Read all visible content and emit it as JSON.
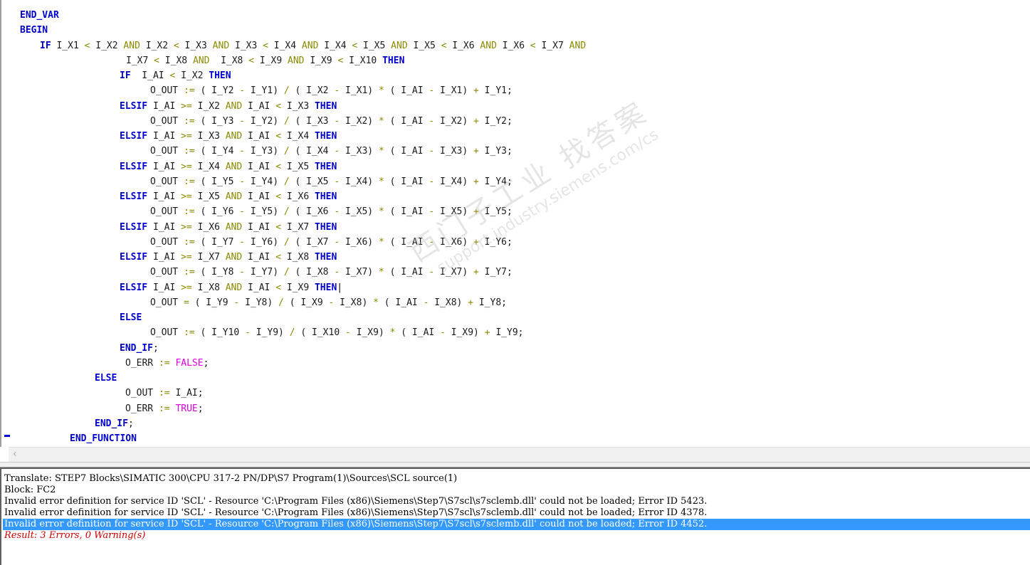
{
  "editor": {
    "lines": [
      [
        [
          "kw",
          "END_VAR"
        ]
      ],
      [
        [
          "kw",
          "BEGIN"
        ]
      ],
      [
        [
          "kw",
          "IF"
        ],
        [
          "txt",
          " I_X1 "
        ],
        [
          "op",
          "<"
        ],
        [
          "txt",
          " I_X2 "
        ],
        [
          "kwa",
          "AND"
        ],
        [
          "txt",
          " I_X2 "
        ],
        [
          "op",
          "<"
        ],
        [
          "txt",
          " I_X3 "
        ],
        [
          "kwa",
          "AND"
        ],
        [
          "txt",
          " I_X3 "
        ],
        [
          "op",
          "<"
        ],
        [
          "txt",
          " I_X4 "
        ],
        [
          "kwa",
          "AND"
        ],
        [
          "txt",
          " I_X4 "
        ],
        [
          "op",
          "<"
        ],
        [
          "txt",
          " I_X5 "
        ],
        [
          "kwa",
          "AND"
        ],
        [
          "txt",
          " I_X5 "
        ],
        [
          "op",
          "<"
        ],
        [
          "txt",
          " I_X6 "
        ],
        [
          "kwa",
          "AND"
        ],
        [
          "txt",
          " I_X6 "
        ],
        [
          "op",
          "<"
        ],
        [
          "txt",
          " I_X7 "
        ],
        [
          "kwa",
          "AND"
        ]
      ],
      [
        [
          "txt",
          "I_X7 "
        ],
        [
          "op",
          "<"
        ],
        [
          "txt",
          " I_X8 "
        ],
        [
          "kwa",
          "AND"
        ],
        [
          "txt",
          "  I_X8 "
        ],
        [
          "op",
          "<"
        ],
        [
          "txt",
          " I_X9 "
        ],
        [
          "kwa",
          "AND"
        ],
        [
          "txt",
          " I_X9 "
        ],
        [
          "op",
          "<"
        ],
        [
          "txt",
          " I_X10 "
        ],
        [
          "kw",
          "THEN"
        ]
      ],
      [
        [
          "kw",
          "IF"
        ],
        [
          "txt",
          "  I_AI "
        ],
        [
          "op",
          "<"
        ],
        [
          "txt",
          " I_X2 "
        ],
        [
          "kw",
          "THEN"
        ]
      ],
      [
        [
          "txt",
          "O_OUT "
        ],
        [
          "op",
          ":="
        ],
        [
          "txt",
          " ( I_Y2 "
        ],
        [
          "op",
          "-"
        ],
        [
          "txt",
          " I_Y1) "
        ],
        [
          "op",
          "/"
        ],
        [
          "txt",
          " ( I_X2 "
        ],
        [
          "op",
          "-"
        ],
        [
          "txt",
          " I_X1) "
        ],
        [
          "op",
          "*"
        ],
        [
          "txt",
          " ( I_AI "
        ],
        [
          "op",
          "-"
        ],
        [
          "txt",
          " I_X1) "
        ],
        [
          "op",
          "+"
        ],
        [
          "txt",
          " I_Y1;"
        ]
      ],
      [
        [
          "kw",
          "ELSIF"
        ],
        [
          "txt",
          " I_AI "
        ],
        [
          "op",
          ">="
        ],
        [
          "txt",
          " I_X2 "
        ],
        [
          "kwa",
          "AND"
        ],
        [
          "txt",
          " I_AI "
        ],
        [
          "op",
          "<"
        ],
        [
          "txt",
          " I_X3 "
        ],
        [
          "kw",
          "THEN"
        ]
      ],
      [
        [
          "txt",
          "O_OUT "
        ],
        [
          "op",
          ":="
        ],
        [
          "txt",
          " ( I_Y3 "
        ],
        [
          "op",
          "-"
        ],
        [
          "txt",
          " I_Y2) "
        ],
        [
          "op",
          "/"
        ],
        [
          "txt",
          " ( I_X3 "
        ],
        [
          "op",
          "-"
        ],
        [
          "txt",
          " I_X2) "
        ],
        [
          "op",
          "*"
        ],
        [
          "txt",
          " ( I_AI "
        ],
        [
          "op",
          "-"
        ],
        [
          "txt",
          " I_X2) "
        ],
        [
          "op",
          "+"
        ],
        [
          "txt",
          " I_Y2;"
        ]
      ],
      [
        [
          "kw",
          "ELSIF"
        ],
        [
          "txt",
          " I_AI "
        ],
        [
          "op",
          ">="
        ],
        [
          "txt",
          " I_X3 "
        ],
        [
          "kwa",
          "AND"
        ],
        [
          "txt",
          " I_AI "
        ],
        [
          "op",
          "<"
        ],
        [
          "txt",
          " I_X4 "
        ],
        [
          "kw",
          "THEN"
        ]
      ],
      [
        [
          "txt",
          "O_OUT "
        ],
        [
          "op",
          ":="
        ],
        [
          "txt",
          " ( I_Y4 "
        ],
        [
          "op",
          "-"
        ],
        [
          "txt",
          " I_Y3) "
        ],
        [
          "op",
          "/"
        ],
        [
          "txt",
          " ( I_X4 "
        ],
        [
          "op",
          "-"
        ],
        [
          "txt",
          " I_X3) "
        ],
        [
          "op",
          "*"
        ],
        [
          "txt",
          " ( I_AI "
        ],
        [
          "op",
          "-"
        ],
        [
          "txt",
          " I_X3) "
        ],
        [
          "op",
          "+"
        ],
        [
          "txt",
          " I_Y3;"
        ]
      ],
      [
        [
          "kw",
          "ELSIF"
        ],
        [
          "txt",
          " I_AI "
        ],
        [
          "op",
          ">="
        ],
        [
          "txt",
          " I_X4 "
        ],
        [
          "kwa",
          "AND"
        ],
        [
          "txt",
          " I_AI "
        ],
        [
          "op",
          "<"
        ],
        [
          "txt",
          " I_X5 "
        ],
        [
          "kw",
          "THEN"
        ]
      ],
      [
        [
          "txt",
          "O_OUT "
        ],
        [
          "op",
          ":="
        ],
        [
          "txt",
          " ( I_Y5 "
        ],
        [
          "op",
          "-"
        ],
        [
          "txt",
          " I_Y4) "
        ],
        [
          "op",
          "/"
        ],
        [
          "txt",
          " ( I_X5 "
        ],
        [
          "op",
          "-"
        ],
        [
          "txt",
          " I_X4) "
        ],
        [
          "op",
          "*"
        ],
        [
          "txt",
          " ( I_AI "
        ],
        [
          "op",
          "-"
        ],
        [
          "txt",
          " I_X4) "
        ],
        [
          "op",
          "+"
        ],
        [
          "txt",
          " I_Y4;"
        ]
      ],
      [
        [
          "kw",
          "ELSIF"
        ],
        [
          "txt",
          " I_AI "
        ],
        [
          "op",
          ">="
        ],
        [
          "txt",
          " I_X5 "
        ],
        [
          "kwa",
          "AND"
        ],
        [
          "txt",
          " I_AI "
        ],
        [
          "op",
          "<"
        ],
        [
          "txt",
          " I_X6 "
        ],
        [
          "kw",
          "THEN"
        ]
      ],
      [
        [
          "txt",
          "O_OUT "
        ],
        [
          "op",
          ":="
        ],
        [
          "txt",
          " ( I_Y6 "
        ],
        [
          "op",
          "-"
        ],
        [
          "txt",
          " I_Y5) "
        ],
        [
          "op",
          "/"
        ],
        [
          "txt",
          " ( I_X6 "
        ],
        [
          "op",
          "-"
        ],
        [
          "txt",
          " I_X5) "
        ],
        [
          "op",
          "*"
        ],
        [
          "txt",
          " ( I_AI "
        ],
        [
          "op",
          "-"
        ],
        [
          "txt",
          " I_X5) "
        ],
        [
          "op",
          "+"
        ],
        [
          "txt",
          " I_Y5;"
        ]
      ],
      [
        [
          "kw",
          "ELSIF"
        ],
        [
          "txt",
          " I_AI "
        ],
        [
          "op",
          ">="
        ],
        [
          "txt",
          " I_X6 "
        ],
        [
          "kwa",
          "AND"
        ],
        [
          "txt",
          " I_AI "
        ],
        [
          "op",
          "<"
        ],
        [
          "txt",
          " I_X7 "
        ],
        [
          "kw",
          "THEN"
        ]
      ],
      [
        [
          "txt",
          "O_OUT "
        ],
        [
          "op",
          ":="
        ],
        [
          "txt",
          " ( I_Y7 "
        ],
        [
          "op",
          "-"
        ],
        [
          "txt",
          " I_Y6) "
        ],
        [
          "op",
          "/"
        ],
        [
          "txt",
          " ( I_X7 "
        ],
        [
          "op",
          "-"
        ],
        [
          "txt",
          " I_X6) "
        ],
        [
          "op",
          "*"
        ],
        [
          "txt",
          " ( I_AI "
        ],
        [
          "op",
          "-"
        ],
        [
          "txt",
          " I_X6) "
        ],
        [
          "op",
          "+"
        ],
        [
          "txt",
          " I_Y6;"
        ]
      ],
      [
        [
          "kw",
          "ELSIF"
        ],
        [
          "txt",
          " I_AI "
        ],
        [
          "op",
          ">="
        ],
        [
          "txt",
          " I_X7 "
        ],
        [
          "kwa",
          "AND"
        ],
        [
          "txt",
          " I_AI "
        ],
        [
          "op",
          "<"
        ],
        [
          "txt",
          " I_X8 "
        ],
        [
          "kw",
          "THEN"
        ]
      ],
      [
        [
          "txt",
          "O_OUT "
        ],
        [
          "op",
          ":="
        ],
        [
          "txt",
          " ( I_Y8 "
        ],
        [
          "op",
          "-"
        ],
        [
          "txt",
          " I_Y7) "
        ],
        [
          "op",
          "/"
        ],
        [
          "txt",
          " ( I_X8 "
        ],
        [
          "op",
          "-"
        ],
        [
          "txt",
          " I_X7) "
        ],
        [
          "op",
          "*"
        ],
        [
          "txt",
          " ( I_AI "
        ],
        [
          "op",
          "-"
        ],
        [
          "txt",
          " I_X7) "
        ],
        [
          "op",
          "+"
        ],
        [
          "txt",
          " I_Y7;"
        ]
      ],
      [
        [
          "kw",
          "ELSIF"
        ],
        [
          "txt",
          " I_AI "
        ],
        [
          "op",
          ">="
        ],
        [
          "txt",
          " I_X8 "
        ],
        [
          "kwa",
          "AND"
        ],
        [
          "txt",
          " I_AI "
        ],
        [
          "op",
          "<"
        ],
        [
          "txt",
          " I_X9 "
        ],
        [
          "kw",
          "THEN"
        ],
        [
          "cur",
          "|"
        ]
      ],
      [
        [
          "txt",
          "O_OUT "
        ],
        [
          "op",
          "="
        ],
        [
          "txt",
          " ( I_Y9 "
        ],
        [
          "op",
          "-"
        ],
        [
          "txt",
          " I_Y8) "
        ],
        [
          "op",
          "/"
        ],
        [
          "txt",
          " ( I_X9 "
        ],
        [
          "op",
          "-"
        ],
        [
          "txt",
          " I_X8) "
        ],
        [
          "op",
          "*"
        ],
        [
          "txt",
          " ( I_AI "
        ],
        [
          "op",
          "-"
        ],
        [
          "txt",
          " I_X8) "
        ],
        [
          "op",
          "+"
        ],
        [
          "txt",
          " I_Y8;"
        ]
      ],
      [
        [
          "kw",
          "ELSE"
        ]
      ],
      [
        [
          "txt",
          "O_OUT "
        ],
        [
          "op",
          ":="
        ],
        [
          "txt",
          " ( I_Y10 "
        ],
        [
          "op",
          "-"
        ],
        [
          "txt",
          " I_Y9) "
        ],
        [
          "op",
          "/"
        ],
        [
          "txt",
          " ( I_X10 "
        ],
        [
          "op",
          "-"
        ],
        [
          "txt",
          " I_X9) "
        ],
        [
          "op",
          "*"
        ],
        [
          "txt",
          " ( I_AI "
        ],
        [
          "op",
          "-"
        ],
        [
          "txt",
          " I_X9) "
        ],
        [
          "op",
          "+"
        ],
        [
          "txt",
          " I_Y9;"
        ]
      ],
      [
        [
          "kw",
          "END_IF"
        ],
        [
          "txt",
          ";"
        ]
      ],
      [
        [
          "txt",
          "O_ERR "
        ],
        [
          "op",
          ":="
        ],
        [
          "txt",
          " "
        ],
        [
          "lit",
          "FALSE"
        ],
        [
          "txt",
          ";"
        ]
      ],
      [
        [
          "kw",
          "ELSE"
        ]
      ],
      [
        [
          "txt",
          "O_OUT "
        ],
        [
          "op",
          ":="
        ],
        [
          "txt",
          " I_AI;"
        ]
      ],
      [
        [
          "txt",
          "O_ERR "
        ],
        [
          "op",
          ":="
        ],
        [
          "txt",
          " "
        ],
        [
          "lit",
          "TRUE"
        ],
        [
          "txt",
          ";"
        ]
      ],
      [
        [
          "kw",
          "END_IF"
        ],
        [
          "txt",
          ";"
        ]
      ],
      [
        [
          "kw",
          "END_FUNCTION"
        ]
      ]
    ]
  },
  "output": {
    "lines": [
      "Translate: STEP7 Blocks\\SIMATIC 300\\CPU 317-2 PN/DP\\S7 Program(1)\\Sources\\SCL source(1)",
      "Block: FC2",
      "Invalid error definition for service ID 'SCL' - Resource 'C:\\Program Files (x86)\\Siemens\\Step7\\S7scl\\s7sclemb.dll' could not be loaded; Error ID 5423.",
      "Invalid error definition for service ID 'SCL' - Resource 'C:\\Program Files (x86)\\Siemens\\Step7\\S7scl\\s7sclemb.dll' could not be loaded; Error ID 4378.",
      "Invalid error definition for service ID 'SCL' - Resource 'C:\\Program Files (x86)\\Siemens\\Step7\\S7scl\\s7sclemb.dll' could not be loaded; Error ID 4452."
    ],
    "selected_index": 4,
    "result": "Result: 3 Errors, 0 Warning(s)"
  },
  "watermark": {
    "text": "西门子工业 找答案",
    "url": "support.industry.siemens.com/cs"
  },
  "scrollbar": {
    "left_arrow_icon": "chevron-left-icon"
  },
  "colors": {
    "keyword": "#0000cc",
    "operator": "#8a8a00",
    "literal": "#e000e0",
    "selection": "#3399ff",
    "result": "#cc0000"
  }
}
